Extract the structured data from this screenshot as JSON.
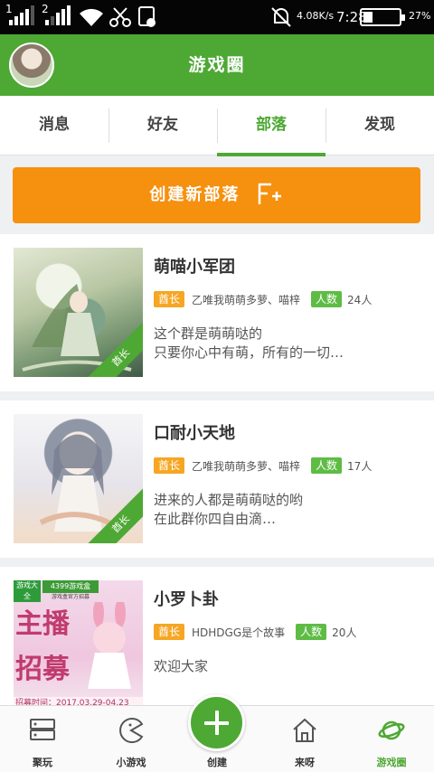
{
  "status_bar": {
    "sim1": "1",
    "sim2": "2",
    "net_speed": "4.08K/s",
    "time": "7:28",
    "battery": "27%",
    "battery_level": 0.27
  },
  "header": {
    "title": "游戏圈"
  },
  "tabs": [
    {
      "label": "消息"
    },
    {
      "label": "好友"
    },
    {
      "label": "部落"
    },
    {
      "label": "发现"
    }
  ],
  "create_button": {
    "label": "创建新部落"
  },
  "tribes": [
    {
      "name": "萌喵小军团",
      "owner_badge": "酋长",
      "owner": "乙唯我萌萌多萝、喵梓",
      "count_badge": "人数",
      "count": "24人",
      "description": "这个群是萌萌哒的\n只要你心中有萌，所有的一切…",
      "ribbon": "酋长"
    },
    {
      "name": "口耐小天地",
      "owner_badge": "酋长",
      "owner": "乙唯我萌萌多萝、喵梓",
      "count_badge": "人数",
      "count": "17人",
      "description": "进来的人都是萌萌哒的哟\n在此群你四自由滴…",
      "ribbon": "酋长"
    },
    {
      "name": "小罗卜卦",
      "owner_badge": "酋长",
      "owner": "HDHDGG是个故事",
      "count_badge": "人数",
      "count": "20人",
      "description": "欢迎大家",
      "poster_top_left": "游戏大全",
      "poster_top": "4399游戏盒",
      "poster_top_sub": "游戏盒官方招募",
      "poster_main1": "主播",
      "poster_main2": "招募",
      "poster_date": "招募时间：2017.03.29-04.23"
    }
  ],
  "bottom_nav": [
    {
      "label": "聚玩",
      "icon": "server-icon"
    },
    {
      "label": "小游戏",
      "icon": "pacman-icon"
    },
    {
      "label": "创建",
      "icon": "plus-icon"
    },
    {
      "label": "来呀",
      "icon": "house-icon"
    },
    {
      "label": "游戏圈",
      "icon": "planet-icon"
    }
  ],
  "colors": {
    "brand_green": "#4ea834",
    "accent_orange": "#f6900f"
  }
}
